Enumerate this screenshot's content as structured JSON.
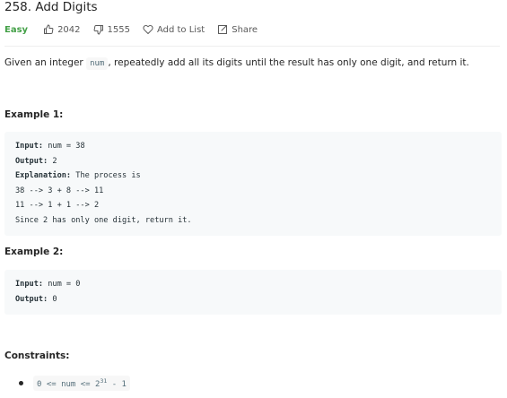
{
  "problem": {
    "title": "258. Add Digits",
    "difficulty": "Easy",
    "likes": "2042",
    "dislikes": "1555",
    "add_to_list": "Add to List",
    "share": "Share",
    "difficulty_color": "#43a047"
  },
  "description": {
    "before": "Given an integer ",
    "code": "num",
    "after": ", repeatedly add all its digits until the result has only one digit, and return it."
  },
  "examples": [
    {
      "heading": "Example 1:",
      "input_label": "Input:",
      "input_value": " num = 38",
      "output_label": "Output:",
      "output_value": " 2",
      "explanation_label": "Explanation:",
      "explanation_value": " The process is",
      "lines": [
        "38 --> 3 + 8 --> 11",
        "11 --> 1 + 1 --> 2",
        "Since 2 has only one digit, return it."
      ]
    },
    {
      "heading": "Example 2:",
      "input_label": "Input:",
      "input_value": " num = 0",
      "output_label": "Output:",
      "output_value": " 0"
    }
  ],
  "constraints": {
    "heading": "Constraints:",
    "item_left": "0 <= num <= 2",
    "item_exp": "31",
    "item_right": " - 1"
  }
}
